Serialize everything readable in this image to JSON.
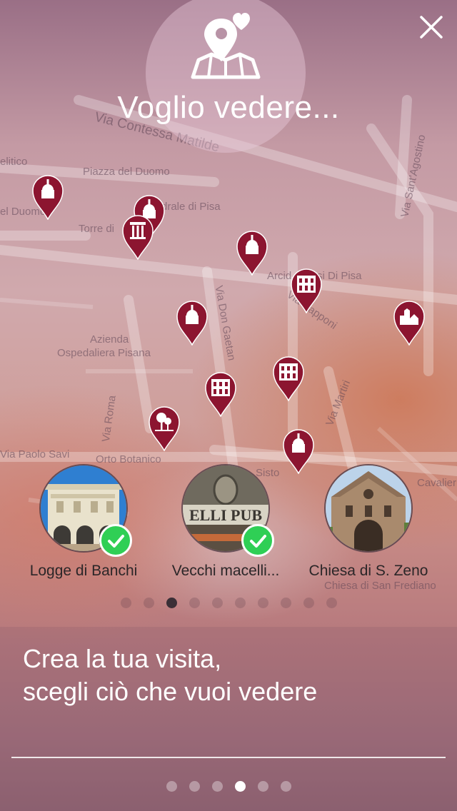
{
  "header": {
    "title": "Voglio vedere...",
    "logo_icon": "map-heart-pin-icon",
    "close_icon": "close-icon"
  },
  "map": {
    "streets": [
      "Via Contessa Matilde",
      "Piazza del Duomo",
      "elitico",
      "el Duomo",
      "Torre di",
      "drale di Pisa",
      "Arcid",
      "si Di Pisa",
      "Via Don Gaetan",
      "Via Capponi",
      "Azienda",
      "Ospedaliera Pisana",
      "Via Roma",
      "Via Martiri",
      "Via Paolo Savi",
      "Orto Botanico",
      "Sisto",
      "Cavalieri",
      "Via Sant'Agostino",
      "Chiesa di San Frediano"
    ],
    "pin_color": "#8c1530",
    "pin_icons": [
      "church-icon",
      "church-icon",
      "column-icon",
      "church-icon",
      "palace-icon",
      "monument-icon",
      "church-icon",
      "palace-icon",
      "palace-icon",
      "garden-icon",
      "church-icon"
    ]
  },
  "places": [
    {
      "label": "Logge di Banchi",
      "selected": true
    },
    {
      "label": "Vecchi macelli...",
      "selected": true
    },
    {
      "label": "Chiesa di S. Zeno",
      "selected": false
    }
  ],
  "carousel_dots": {
    "count": 10,
    "active": 2
  },
  "caption": {
    "line1": "Crea la tua visita,",
    "line2": "scegli ciò che vuoi vedere"
  },
  "page_dots": {
    "count": 6,
    "active": 3
  },
  "colors": {
    "accent": "#8c1530",
    "check": "#2fcf55"
  }
}
